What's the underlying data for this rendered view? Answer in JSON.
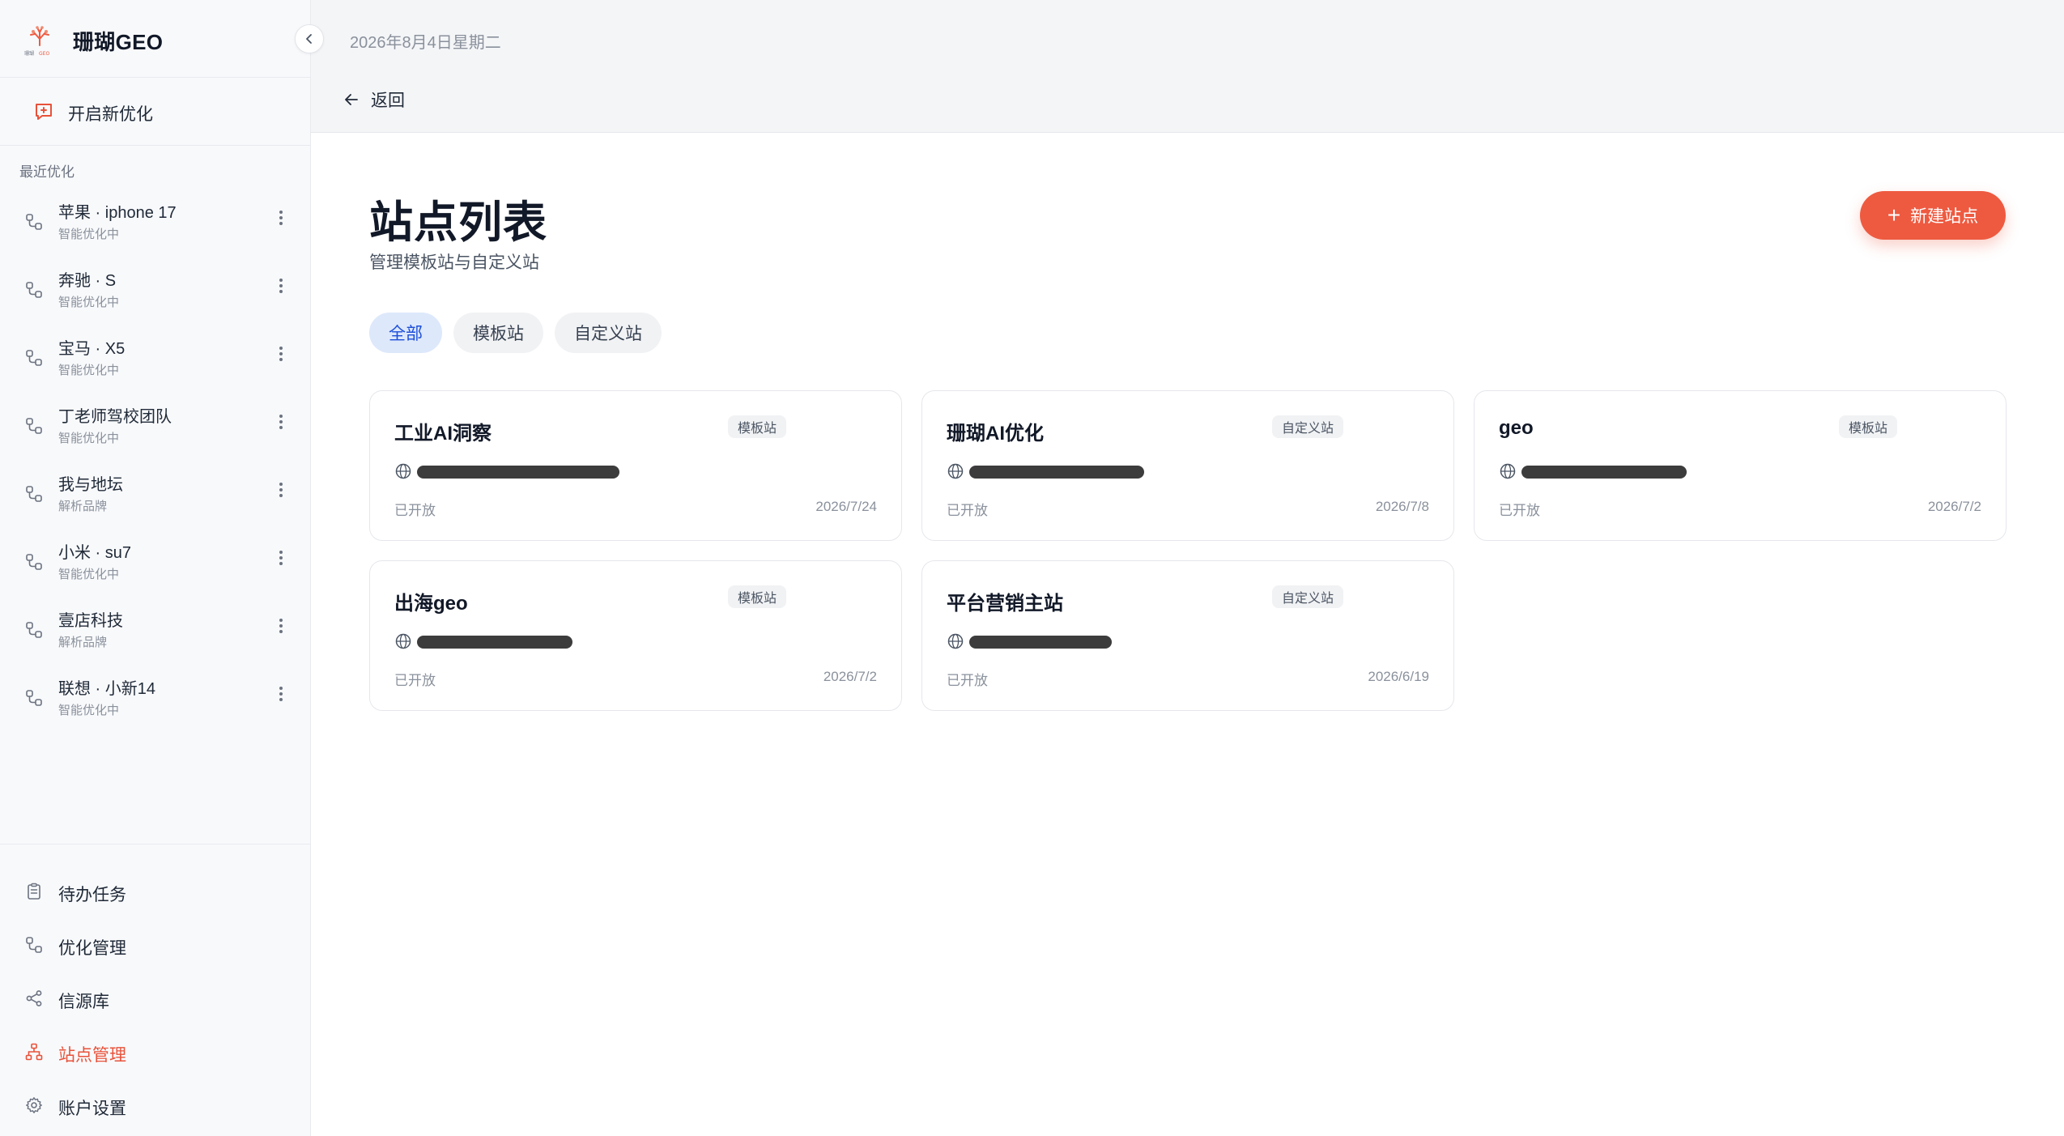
{
  "brand": {
    "name": "珊瑚GEO",
    "logo_text": "珊瑚GEO"
  },
  "sidebar": {
    "new_optimization": "开启新优化",
    "recent_title": "最近优化",
    "recent": [
      {
        "title": "苹果 · iphone 17",
        "status": "智能优化中"
      },
      {
        "title": "奔驰 · S",
        "status": "智能优化中"
      },
      {
        "title": "宝马 · X5",
        "status": "智能优化中"
      },
      {
        "title": "丁老师驾校团队",
        "status": "智能优化中"
      },
      {
        "title": "我与地坛",
        "status": "解析品牌"
      },
      {
        "title": "小米 · su7",
        "status": "智能优化中"
      },
      {
        "title": "壹店科技",
        "status": "解析品牌"
      },
      {
        "title": "联想 · 小新14",
        "status": "智能优化中"
      }
    ],
    "nav": [
      {
        "label": "待办任务",
        "icon": "clipboard-icon",
        "active": false
      },
      {
        "label": "优化管理",
        "icon": "flow-icon",
        "active": false
      },
      {
        "label": "信源库",
        "icon": "share-icon",
        "active": false
      },
      {
        "label": "站点管理",
        "icon": "sitemap-icon",
        "active": true
      },
      {
        "label": "账户设置",
        "icon": "gear-icon",
        "active": false
      }
    ]
  },
  "topbar": {
    "date": "2026年8月4日星期二",
    "back_label": "返回"
  },
  "main": {
    "title": "站点列表",
    "subtitle": "管理模板站与自定义站",
    "create_button": "新建站点",
    "filters": [
      "全部",
      "模板站",
      "自定义站"
    ],
    "active_filter": "全部",
    "sites": [
      {
        "name": "工业AI洞察",
        "type": "模板站",
        "status": "已开放",
        "date": "2026/7/24"
      },
      {
        "name": "珊瑚AI优化",
        "type": "自定义站",
        "status": "已开放",
        "date": "2026/7/8"
      },
      {
        "name": "geo",
        "type": "模板站",
        "status": "已开放",
        "date": "2026/7/2"
      },
      {
        "name": "出海geo",
        "type": "模板站",
        "status": "已开放",
        "date": "2026/7/2"
      },
      {
        "name": "平台营销主站",
        "type": "自定义站",
        "status": "已开放",
        "date": "2026/6/19"
      }
    ]
  },
  "colors": {
    "accent": "#ee5a40",
    "active_filter_bg": "#dde8fb",
    "active_filter_text": "#1d4ed8"
  }
}
